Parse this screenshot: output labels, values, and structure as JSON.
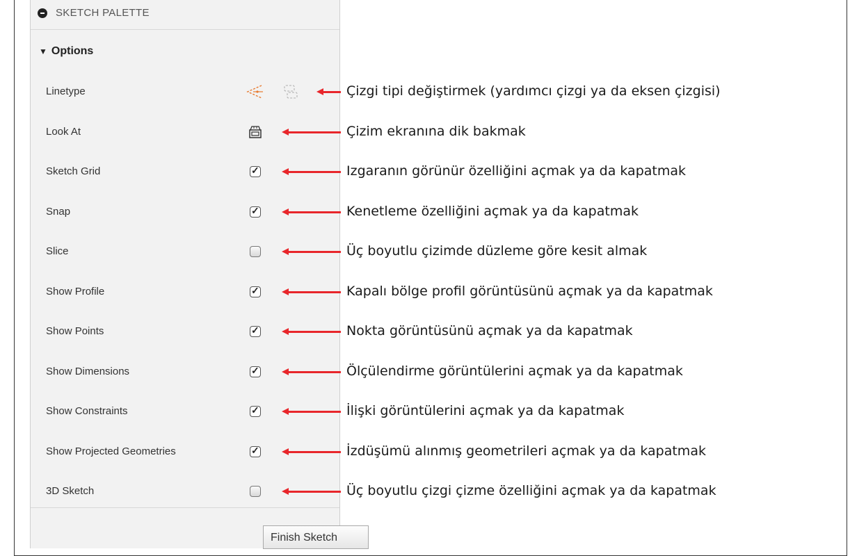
{
  "palette": {
    "title": "SKETCH PALETTE",
    "options_label": "Options",
    "finish_button": "Finish Sketch"
  },
  "rows": [
    {
      "label": "Linetype",
      "control": "linetype-icons",
      "checked": null,
      "description": "Çizgi tipi değiştirmek (yardımcı çizgi ya da eksen çizgisi)"
    },
    {
      "label": "Look At",
      "control": "look-at-icon",
      "checked": null,
      "description": "Çizim ekranına dik bakmak"
    },
    {
      "label": "Sketch Grid",
      "control": "checkbox",
      "checked": true,
      "description": "Izgaranın görünür özelliğini açmak ya da kapatmak"
    },
    {
      "label": "Snap",
      "control": "checkbox",
      "checked": true,
      "description": "Kenetleme özelliğini açmak ya da kapatmak"
    },
    {
      "label": "Slice",
      "control": "checkbox",
      "checked": false,
      "description": "Üç boyutlu çizimde düzleme göre kesit almak"
    },
    {
      "label": "Show Profile",
      "control": "checkbox",
      "checked": true,
      "description": "Kapalı bölge profil görüntüsünü açmak ya da kapatmak"
    },
    {
      "label": "Show Points",
      "control": "checkbox",
      "checked": true,
      "description": "Nokta görüntüsünü açmak ya da kapatmak"
    },
    {
      "label": "Show Dimensions",
      "control": "checkbox",
      "checked": true,
      "description": "Ölçülendirme görüntülerini açmak ya da kapatmak"
    },
    {
      "label": "Show Constraints",
      "control": "checkbox",
      "checked": true,
      "description": "İlişki görüntülerini açmak ya da kapatmak"
    },
    {
      "label": "Show Projected Geometries",
      "control": "checkbox",
      "checked": true,
      "description": "İzdüşümü alınmış geometrileri açmak ya da kapatmak"
    },
    {
      "label": "3D Sketch",
      "control": "checkbox",
      "checked": false,
      "description": "Üç boyutlu çizgi çizme özelliğini açmak ya da kapatmak"
    }
  ],
  "colors": {
    "arrow": "#e8262b",
    "panel": "#f2f2f2"
  }
}
